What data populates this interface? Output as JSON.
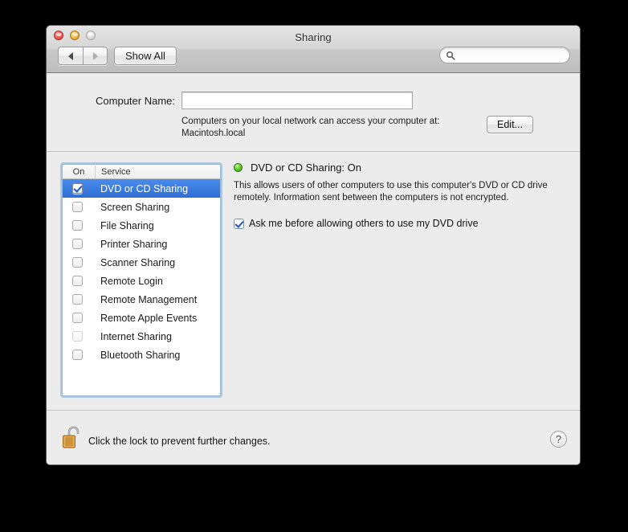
{
  "window": {
    "title": "Sharing"
  },
  "traffic_lights": {
    "close": "close-button",
    "minimize": "minimize-button",
    "zoom": "zoom-button"
  },
  "toolbar": {
    "back_label": "Back",
    "forward_label": "Forward",
    "show_all_label": "Show All",
    "search_value": "",
    "search_placeholder": ""
  },
  "computer_name": {
    "label": "Computer Name:",
    "value": "",
    "placeholder": "",
    "access_text": "Computers on your local network can access your computer at: Macintosh.local",
    "hostname": "Macintosh.local",
    "edit_label": "Edit..."
  },
  "service_list": {
    "header_on": "On",
    "header_service": "Service",
    "items": [
      {
        "label": "DVD or CD Sharing",
        "checked": true,
        "selected": true,
        "disabled": false
      },
      {
        "label": "Screen Sharing",
        "checked": false,
        "selected": false,
        "disabled": false
      },
      {
        "label": "File Sharing",
        "checked": false,
        "selected": false,
        "disabled": false
      },
      {
        "label": "Printer Sharing",
        "checked": false,
        "selected": false,
        "disabled": false
      },
      {
        "label": "Scanner Sharing",
        "checked": false,
        "selected": false,
        "disabled": false
      },
      {
        "label": "Remote Login",
        "checked": false,
        "selected": false,
        "disabled": false
      },
      {
        "label": "Remote Management",
        "checked": false,
        "selected": false,
        "disabled": false
      },
      {
        "label": "Remote Apple Events",
        "checked": false,
        "selected": false,
        "disabled": false
      },
      {
        "label": "Internet Sharing",
        "checked": false,
        "selected": false,
        "disabled": true
      },
      {
        "label": "Bluetooth Sharing",
        "checked": false,
        "selected": false,
        "disabled": false
      }
    ]
  },
  "detail": {
    "status_title": "DVD or CD Sharing: On",
    "status_color": "#46b41e",
    "description": "This allows users of other computers to use this computer's DVD or CD drive remotely. Information sent between the computers is not encrypted.",
    "ask_checkbox_label": "Ask me before allowing others to use my DVD drive",
    "ask_checkbox_checked": true
  },
  "footer": {
    "lock_text": "Click the lock to prevent further changes.",
    "lock_state": "unlocked",
    "help_label": "?"
  }
}
